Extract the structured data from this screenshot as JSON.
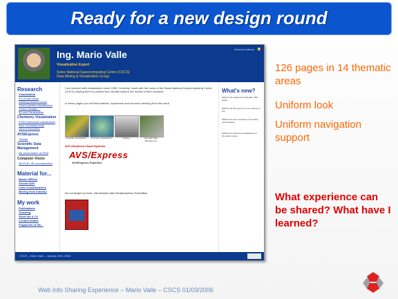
{
  "slide": {
    "title": "Ready for a new design round",
    "bullets": [
      "126 pages in 14 thematic areas",
      "Uniform look",
      "Uniform navigation support"
    ],
    "question": "What experience can be shared? What have I learned?",
    "footer": "Web Info Sharing Experience – Mario Valle – CSCS 01/03/2006"
  },
  "website": {
    "name": "Ing. Mario Valle",
    "role": "Visualization Expert",
    "org_line1": "Swiss National Supercomputing Centre (CSCS)",
    "org_line2": "Data Mining & Visualization Group",
    "tiny_link": "Versione italiana",
    "left_sections": [
      {
        "title": "Research",
        "links": [
          "Visualization",
          "For a new vision",
          "Defining related search",
          "Three problem visualization",
          "Chaos, Images ...",
          "3D and Visualization"
        ]
      },
      {
        "title": "Chemistry Visualization",
        "links": [
          "STM3 interactive visualization",
          "Pyro Chemistry tools",
          "Neural simulation"
        ]
      },
      {
        "title": "AVS/Express",
        "links": [
          "Tutorial"
        ]
      },
      {
        "title": "Scientific Data Management",
        "links": [
          "My presentation at SDM"
        ]
      },
      {
        "title": "Computer Vision",
        "links": [
          "MUSCEL 3D reconstruction"
        ]
      },
      {
        "title": "Material for...",
        "links": [
          "Master MRCIA",
          "Scuola SAFI",
          "Libro visualizzazione",
          "Moving from industry"
        ]
      },
      {
        "title": "My work",
        "links": [
          "Publications",
          "Teaching",
          "Short bio & CV",
          "Contact details",
          "Fragments of life..."
        ]
      }
    ],
    "intro_text": "I am involved with visualization since 1995. Currently I work with the users of the Swiss National Supercomputing Centre (CSCS) helping them to present and visually explore the results of their research.",
    "intro_text2": "In these pages you will find material, experience and resource deriving from this work.",
    "thumb_captions": [
      "Scientific Visualization",
      "Chemistry Visualization",
      "Training",
      "Scientific Data Management"
    ],
    "avs_small": "AVS Advanced Visual Systems",
    "avs_logo": "AVS/Express",
    "avs_sub": "AVS/Express Expertise",
    "book_line": "Do not forget my book: Introduzione alla Visualizzazione Scientifica",
    "whats_new_title": "What's new?",
    "whats_new_items": [
      "2006-01-20 Updated the MolekEL VMD plugin.",
      "2006-01-20 My book is out, be ordered on line.",
      "2006-01-21 New examples of chemistry representation.",
      "2006-01-12 Advanced visualization for chemistry course"
    ],
    "footer_text": "CSCS – Mario Valle – January 20th, 2006"
  },
  "colors": {
    "title_bar": "#0b55cf",
    "bullet": "#ff6600",
    "question": "#e00000",
    "site_header": "#0b3a8e"
  }
}
